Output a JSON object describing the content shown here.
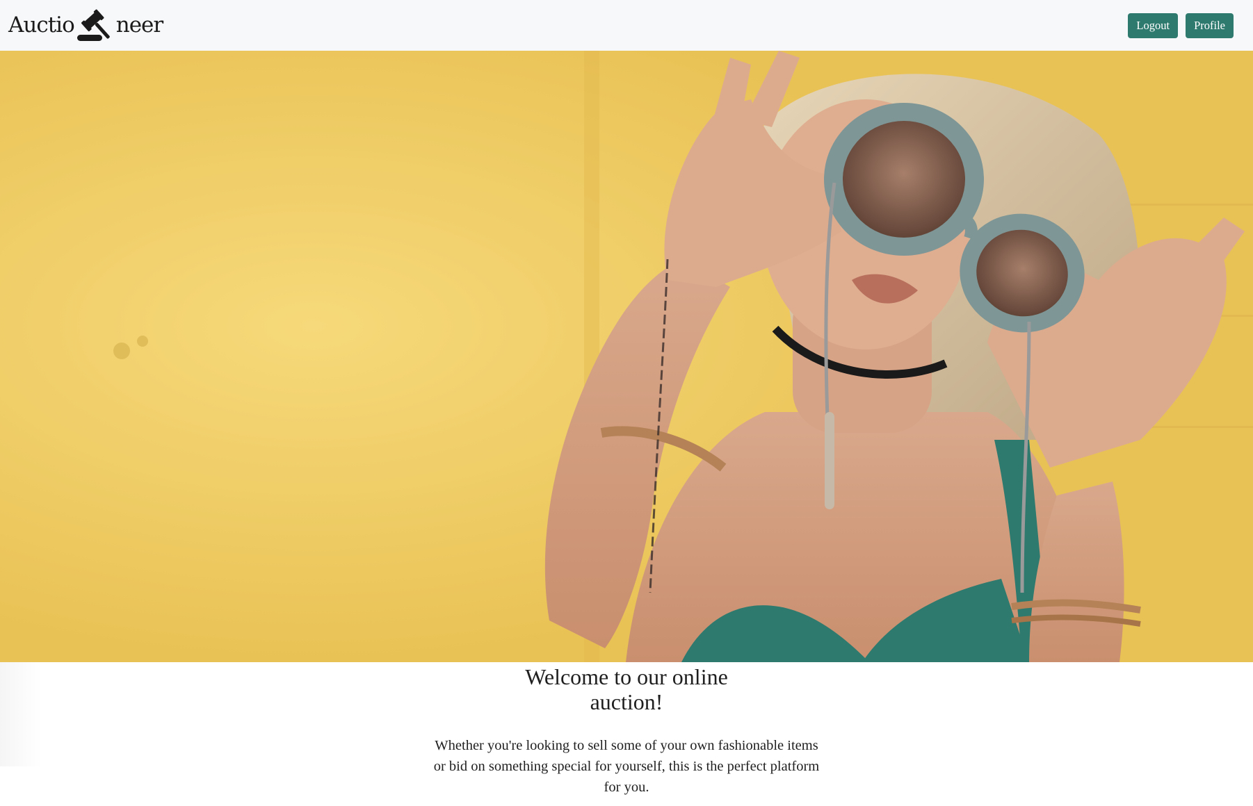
{
  "brand": {
    "name_left": "Auctio",
    "name_right": "neer",
    "logo_icon": "gavel-icon"
  },
  "nav": {
    "logout_label": "Logout",
    "profile_label": "Profile"
  },
  "hero": {
    "image_alt": "Woman with round sunglasses in front of a yellow wall"
  },
  "intro": {
    "title": "Welcome to our online auction!",
    "text": "Whether you're looking to sell some of your own fashionable items or bid on something special for yourself, this is the perfect platform for you."
  },
  "colors": {
    "nav_background": "#f7f8fa",
    "button_background": "#2f7a6f",
    "button_text": "#ffffff",
    "text": "#1f1f1f",
    "hero_wall": "#f0cc58"
  }
}
